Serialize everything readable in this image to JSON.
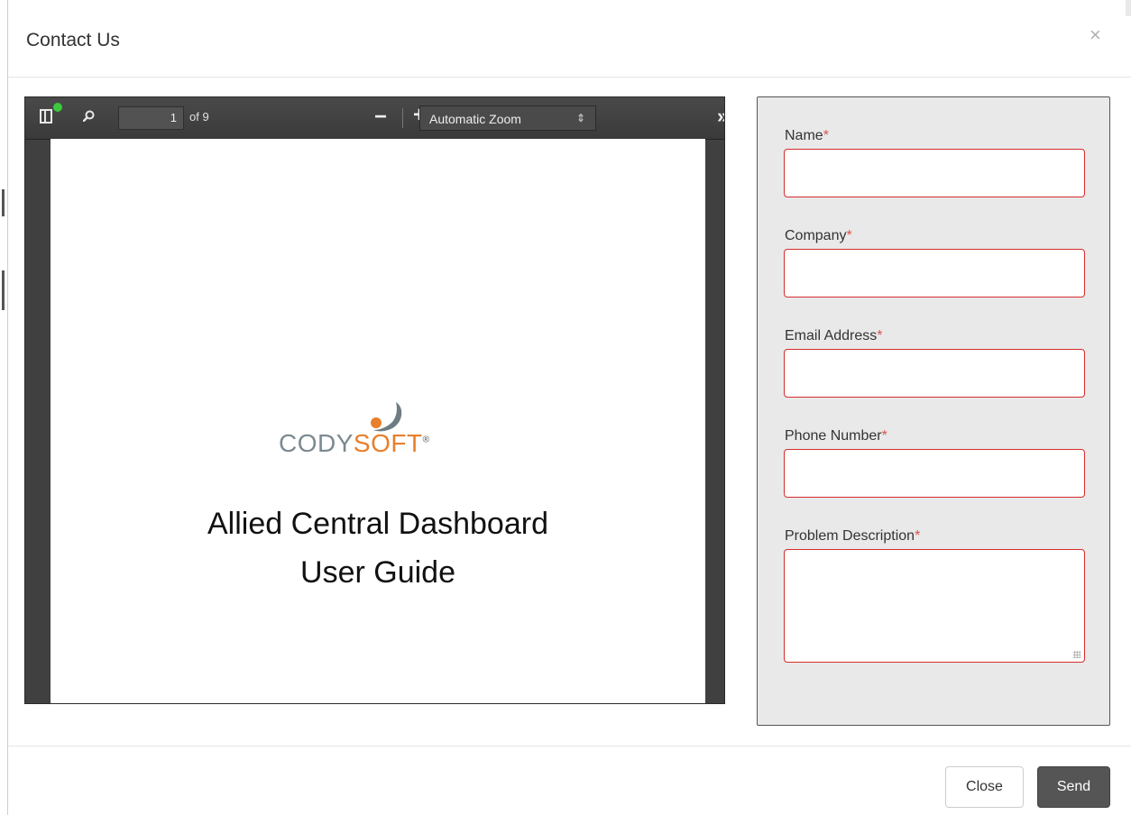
{
  "modal": {
    "title": "Contact Us",
    "close_glyph": "×"
  },
  "pdf_viewer": {
    "toolbar": {
      "page_number": "1",
      "page_count_text": "of 9",
      "zoom_out_glyph": "−",
      "zoom_in_glyph": "+",
      "zoom_value": "Automatic Zoom",
      "more_glyph": "»"
    },
    "document": {
      "logo_part1": "CODY",
      "logo_part2": "SOFT",
      "logo_registered": "®",
      "title_line1": "Allied Central Dashboard",
      "title_line2": "User Guide"
    },
    "icons": [
      "sidebar-toggle-icon",
      "search-icon",
      "chevron-up-icon",
      "chevron-down-icon"
    ]
  },
  "form": {
    "required_marker": "*",
    "fields": [
      {
        "label": "Name",
        "value": ""
      },
      {
        "label": "Company",
        "value": ""
      },
      {
        "label": "Email Address",
        "value": ""
      },
      {
        "label": "Phone Number",
        "value": ""
      },
      {
        "label": "Problem Description",
        "value": ""
      }
    ]
  },
  "footer": {
    "close_label": "Close",
    "send_label": "Send"
  },
  "colors": {
    "required": "#d9534f",
    "invalid_border": "#d62d2d",
    "logo_grey": "#7c8a91",
    "logo_orange": "#e87f2c",
    "send_bg": "#555555",
    "status_dot": "#3cc83c"
  }
}
